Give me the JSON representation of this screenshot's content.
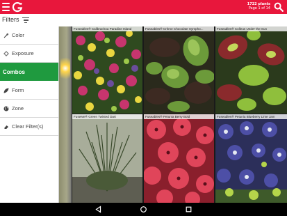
{
  "header": {
    "logo_icon": "garden-g-logo-icon",
    "count_number": "1722",
    "count_label": "plants",
    "page_label": "Page 1 of 14",
    "menu_icon": "hamburger-menu-icon",
    "search_icon": "search-icon",
    "brand_color": "#e8173c"
  },
  "filters": {
    "label": "Filters",
    "sort_icon": "sort-lines-icon",
    "items": [
      {
        "label": "Color",
        "icon": "eyedropper-icon",
        "active": false
      },
      {
        "label": "Exposure",
        "icon": "sun-icon",
        "active": false
      },
      {
        "label": "Combos",
        "icon": "",
        "active": true
      },
      {
        "label": "Form",
        "icon": "leaf-icon",
        "active": false
      },
      {
        "label": "Zone",
        "icon": "globe-icon",
        "active": false
      },
      {
        "label": "Clear Filter(s)",
        "icon": "eraser-icon",
        "active": false
      }
    ],
    "active_color": "#1f9a3f"
  },
  "plants": [
    {
      "caption": "Fuseables® Calibrachoa Paradise Island"
    },
    {
      "caption": "Fuseables® Crème Chocolate Sympho..."
    },
    {
      "caption": "Fuseables® Colleus Under the Sun"
    },
    {
      "caption": "FuseMe® Green Twisted Dart"
    },
    {
      "caption": "Fuseables® Petunia Berry Bold"
    },
    {
      "caption": "Fuseables® Petunia Blueberry Lime Jam"
    }
  ],
  "navigation": {
    "back_icon": "back-triangle-icon",
    "home_icon": "home-circle-icon",
    "recents_icon": "recents-square-icon"
  }
}
